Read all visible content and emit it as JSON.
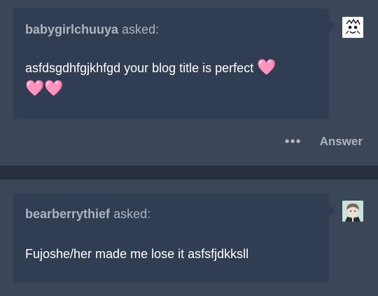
{
  "posts": [
    {
      "asker": "babygirlchuuya",
      "asked_label": "asked:",
      "question_text": "asfdsgdhfgjkhfgd your blog title is perfect",
      "hearts_inline": "🩷",
      "hearts_after": "🩷🩷",
      "avatar_icon": "manga-face-icon"
    },
    {
      "asker": "bearberrythief",
      "asked_label": "asked:",
      "question_text": "Fujoshe/her made me lose it asfsfjdkksll",
      "avatar_icon": "anime-character-icon"
    }
  ],
  "footer": {
    "more_label": "•••",
    "answer_label": "Answer"
  },
  "colors": {
    "background": "#3c4659",
    "bubble": "#313d52",
    "divider": "#263041",
    "muted_text": "#aeb4bf",
    "heart": "#ff9fcf"
  }
}
